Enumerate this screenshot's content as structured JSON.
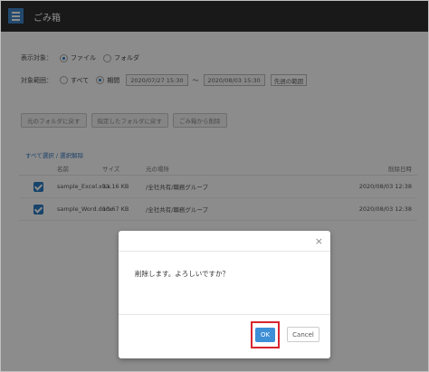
{
  "header": {
    "title": "ごみ箱"
  },
  "display_target": {
    "label": "表示対象：",
    "options": [
      "ファイル",
      "フォルダ"
    ],
    "selected": "ファイル"
  },
  "date_range": {
    "label": "対象範囲：",
    "option_all": "すべて",
    "option_period": "期間",
    "selected": "期間",
    "start": "2020/07/27 15:30",
    "separator": "〜",
    "end": "2020/08/03 15:30",
    "preset": "先週の範囲"
  },
  "actions": [
    "元のフォルダに戻す",
    "指定したフォルダに戻す",
    "ごみ箱から削除"
  ],
  "select_links": "すべて選択 / 選択解除",
  "table": {
    "columns": [
      "名前",
      "サイズ",
      "元の場所",
      "削除日時"
    ],
    "rows": [
      {
        "name": "sample_Excel.xlsx",
        "size": "11.16 KB",
        "path": "/全社共有/職務グループ",
        "date": "2020/08/03 12:38"
      },
      {
        "name": "sample_Word.docx",
        "size": "13.67 KB",
        "path": "/全社共有/職務グループ",
        "date": "2020/08/03 12:38"
      }
    ]
  },
  "dialog": {
    "message": "削除します。よろしいですか？",
    "ok_label": "OK",
    "cancel_label": "Cancel",
    "close_glyph": "×"
  },
  "colors": {
    "accent": "#3d8fd6",
    "highlight": "#d7262e",
    "header_bg": "#2e2e2e"
  }
}
